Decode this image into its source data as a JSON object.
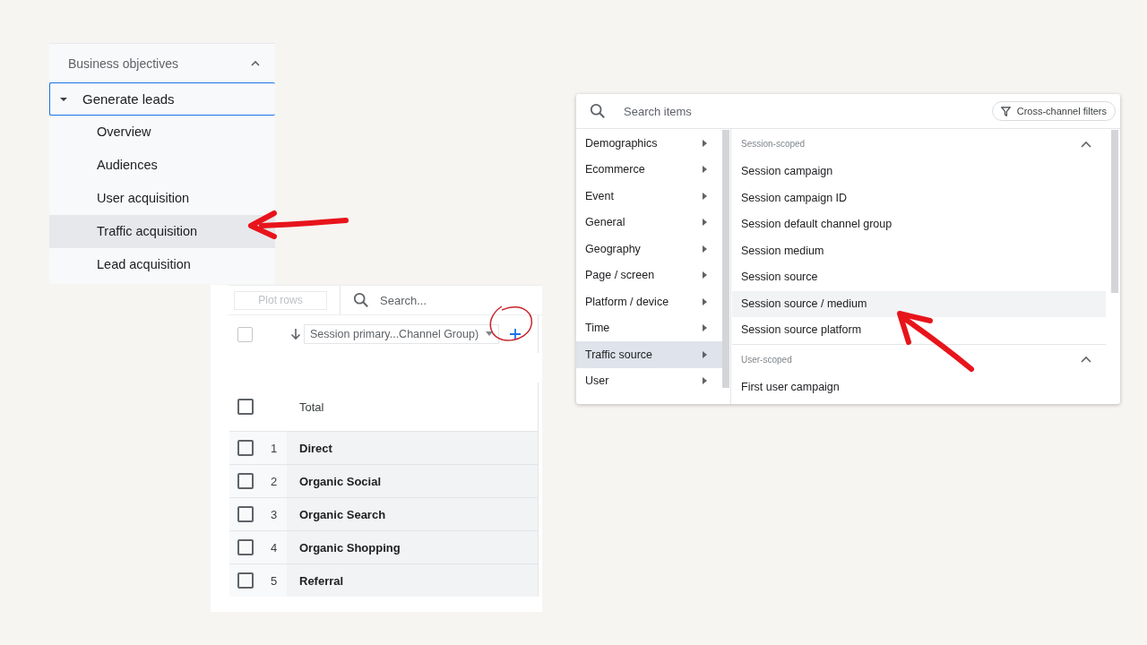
{
  "sidebar": {
    "section": {
      "label": "Business objectives",
      "expanded": true
    },
    "items": [
      {
        "label": "Generate leads",
        "selected": true,
        "expanded": true,
        "children": [
          {
            "label": "Overview",
            "selected": false
          },
          {
            "label": "Audiences",
            "selected": false
          },
          {
            "label": "User acquisition",
            "selected": false
          },
          {
            "label": "Traffic acquisition",
            "selected": true
          },
          {
            "label": "Lead acquisition",
            "selected": false
          }
        ]
      }
    ]
  },
  "table": {
    "plot_rows_button": {
      "label": "Plot rows",
      "disabled": true
    },
    "search": {
      "placeholder": "Search..."
    },
    "dimension": {
      "label": "Session primary...Channel Group)"
    },
    "total": {
      "label": "Total",
      "checked": false
    },
    "header_checked": false,
    "rows": [
      {
        "index": "1",
        "name": "Direct",
        "checked": false
      },
      {
        "index": "2",
        "name": "Organic Social",
        "checked": false
      },
      {
        "index": "3",
        "name": "Organic Search",
        "checked": false
      },
      {
        "index": "4",
        "name": "Organic Shopping",
        "checked": false
      },
      {
        "index": "5",
        "name": "Referral",
        "checked": false
      }
    ]
  },
  "picker": {
    "search": {
      "placeholder": "Search items"
    },
    "filter_button": "Cross-channel filters",
    "categories": [
      {
        "label": "Demographics",
        "selected": false
      },
      {
        "label": "Ecommerce",
        "selected": false
      },
      {
        "label": "Event",
        "selected": false
      },
      {
        "label": "General",
        "selected": false
      },
      {
        "label": "Geography",
        "selected": false
      },
      {
        "label": "Page / screen",
        "selected": false
      },
      {
        "label": "Platform / device",
        "selected": false
      },
      {
        "label": "Time",
        "selected": false
      },
      {
        "label": "Traffic source",
        "selected": true
      },
      {
        "label": "User",
        "selected": false
      }
    ],
    "groups": [
      {
        "label": "Session-scoped",
        "expanded": true,
        "items": [
          {
            "label": "Session campaign",
            "selected": false
          },
          {
            "label": "Session campaign ID",
            "selected": false
          },
          {
            "label": "Session default channel group",
            "selected": false
          },
          {
            "label": "Session medium",
            "selected": false
          },
          {
            "label": "Session source",
            "selected": false
          },
          {
            "label": "Session source / medium",
            "selected": true
          },
          {
            "label": "Session source platform",
            "selected": false
          }
        ]
      },
      {
        "label": "User-scoped",
        "expanded": true,
        "items": [
          {
            "label": "First user campaign",
            "selected": false
          }
        ]
      }
    ]
  }
}
